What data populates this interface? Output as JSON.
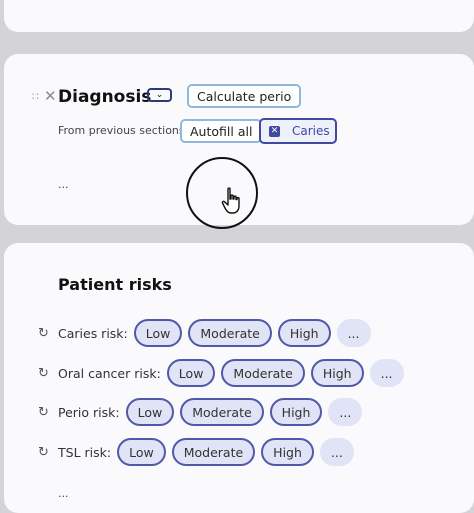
{
  "diagnosis": {
    "title": "Diagnosis",
    "drag_handle": "∷",
    "remove_glyph": "✕",
    "collapse_glyph": "⌄",
    "calculate_label": "Calculate perio",
    "from_previous_label": "From previous sections:",
    "autofill_label": "Autofill all",
    "chip": {
      "label": "Caries",
      "remove_glyph": "✕"
    },
    "ellipsis": "..."
  },
  "risks": {
    "title": "Patient risks",
    "options": [
      "Low",
      "Moderate",
      "High"
    ],
    "more": "...",
    "rows": [
      {
        "label": "Caries risk:"
      },
      {
        "label": "Oral cancer risk:"
      },
      {
        "label": "Perio risk:"
      },
      {
        "label": "TSL risk:"
      }
    ],
    "ellipsis": "..."
  },
  "icons": {
    "drag": "drag-handle-icon",
    "remove": "close-icon",
    "collapse": "chevron-down-icon",
    "cycle": "cycle-icon",
    "cursor": "hand-pointer-icon"
  },
  "colors": {
    "background": "#d4d4d6",
    "card": "#fafafc",
    "accent": "#3f4aa0",
    "pill_fill": "#e1e3f6",
    "button_border": "#8fb8e0"
  }
}
